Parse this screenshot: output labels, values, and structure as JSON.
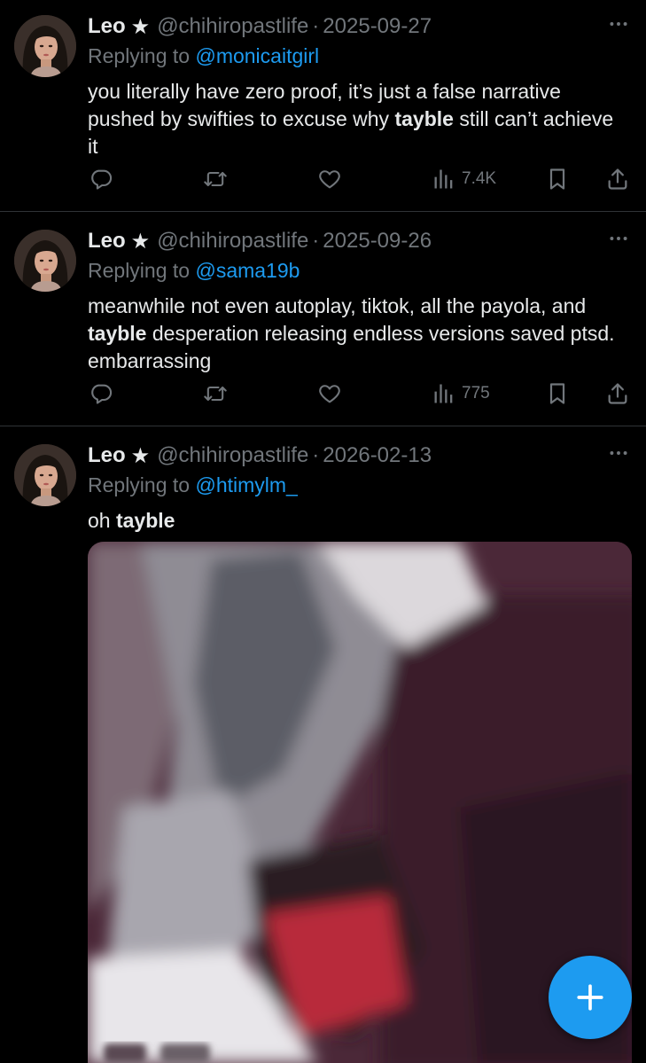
{
  "tweets": [
    {
      "name": "Leo",
      "star": "★",
      "handle": "@chihiropastlife",
      "sep": "·",
      "date": "2025-09-27",
      "reply_prefix": "Replying to",
      "reply_to": "@monicaitgirl",
      "text_before": "you literally have zero proof, it’s just a false narrative pushed by swifties to excuse why ",
      "text_bold": "tayble",
      "text_after": " still can’t achieve it",
      "views": "7.4K"
    },
    {
      "name": "Leo",
      "star": "★",
      "handle": "@chihiropastlife",
      "sep": "·",
      "date": "2025-09-26",
      "reply_prefix": "Replying to",
      "reply_to": "@sama19b",
      "text_before": "meanwhile not even autoplay, tiktok, all the payola, and ",
      "text_bold": "tayble",
      "text_after": " desperation releasing endless versions saved ptsd. embarrassing",
      "views": "775"
    },
    {
      "name": "Leo",
      "star": "★",
      "handle": "@chihiropastlife",
      "sep": "·",
      "date": "2026-02-13",
      "reply_prefix": "Replying to",
      "reply_to": "@htimylm_",
      "text_before": "oh ",
      "text_bold": "tayble",
      "text_after": ""
    }
  ],
  "icons": {
    "more": "more-horizontal-icon",
    "reply": "reply-icon",
    "retweet": "retweet-icon",
    "like": "heart-icon",
    "views": "views-icon",
    "bookmark": "bookmark-icon",
    "share": "share-icon",
    "compose": "plus-icon"
  },
  "colors": {
    "background": "#000000",
    "text": "#e7e9ea",
    "muted": "#71767b",
    "accent": "#1d9bf0",
    "divider": "#2f3336"
  }
}
